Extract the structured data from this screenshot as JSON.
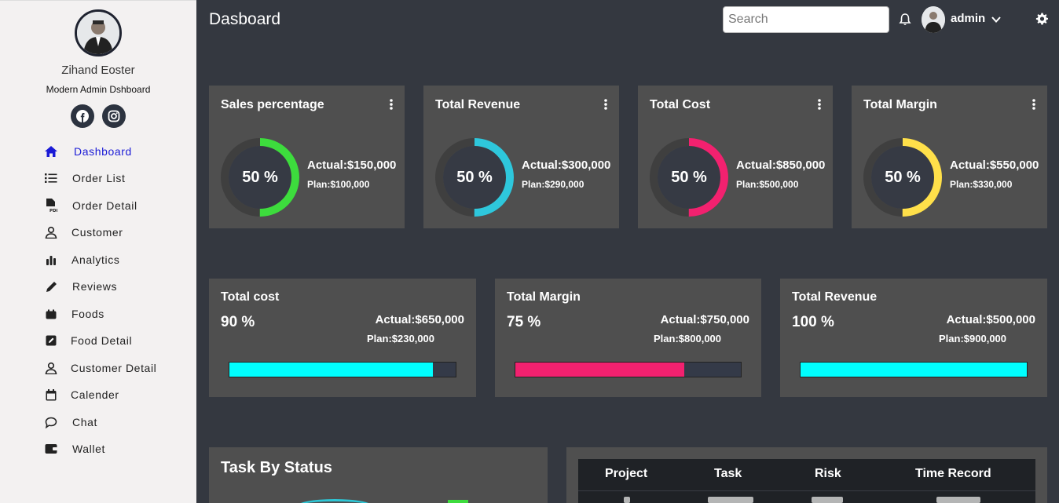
{
  "sidebar": {
    "user_name": "Zihand Eoster",
    "user_subtitle": "Modern Admin Dshboard",
    "social": [
      "facebook-icon",
      "instagram-icon"
    ],
    "items": [
      {
        "label": "Dashboard",
        "icon": "home-icon",
        "active": true
      },
      {
        "label": "Order List",
        "icon": "list-icon"
      },
      {
        "label": "Order Detail",
        "icon": "pdf-file-icon"
      },
      {
        "label": "Customer",
        "icon": "user-icon"
      },
      {
        "label": "Analytics",
        "icon": "bar-chart-icon"
      },
      {
        "label": "Reviews",
        "icon": "pencil-icon"
      },
      {
        "label": "Foods",
        "icon": "box-icon"
      },
      {
        "label": "Food Detail",
        "icon": "edit-square-icon"
      },
      {
        "label": "Customer Detail",
        "icon": "user-icon"
      },
      {
        "label": "Calender",
        "icon": "calendar-icon"
      },
      {
        "label": "Chat",
        "icon": "chat-bubble-icon"
      },
      {
        "label": "Wallet",
        "icon": "wallet-icon"
      }
    ]
  },
  "header": {
    "title": "Dasboard",
    "search_placeholder": "Search",
    "admin_label": "admin"
  },
  "kpis": [
    {
      "title": "Sales percentage",
      "percent": 50,
      "percent_label": "50 %",
      "actual": "Actual:$150,000",
      "plan": "Plan:$100,000",
      "color": "#3ddc3d"
    },
    {
      "title": "Total Revenue",
      "percent": 50,
      "percent_label": "50 %",
      "actual": "Actual:$300,000",
      "plan": "Plan:$290,000",
      "color": "#2ec7dc"
    },
    {
      "title": "Total Cost",
      "percent": 50,
      "percent_label": "50 %",
      "actual": "Actual:$850,000",
      "plan": "Plan:$500,000",
      "color": "#f2216f"
    },
    {
      "title": "Total Margin",
      "percent": 50,
      "percent_label": "50 %",
      "actual": "Actual:$550,000",
      "plan": "Plan:$330,000",
      "color": "#ffe04a"
    }
  ],
  "progress_cards": [
    {
      "title": "Total cost",
      "percent": 90,
      "percent_label": "90 %",
      "actual": "Actual:$650,000",
      "plan": "Plan:$230,000",
      "color": "#00ffff"
    },
    {
      "title": "Total Margin",
      "percent": 75,
      "percent_label": "75 %",
      "actual": "Actual:$750,000",
      "plan": "Plan:$800,000",
      "color": "#f2216f"
    },
    {
      "title": "Total Revenue",
      "percent": 100,
      "percent_label": "100 %",
      "actual": "Actual:$500,000",
      "plan": "Plan:$900,000",
      "color": "#00ffff"
    }
  ],
  "task_panel": {
    "title": "Task By Status"
  },
  "table": {
    "headers": [
      "Project",
      "Task",
      "Risk",
      "Time Record"
    ]
  }
}
